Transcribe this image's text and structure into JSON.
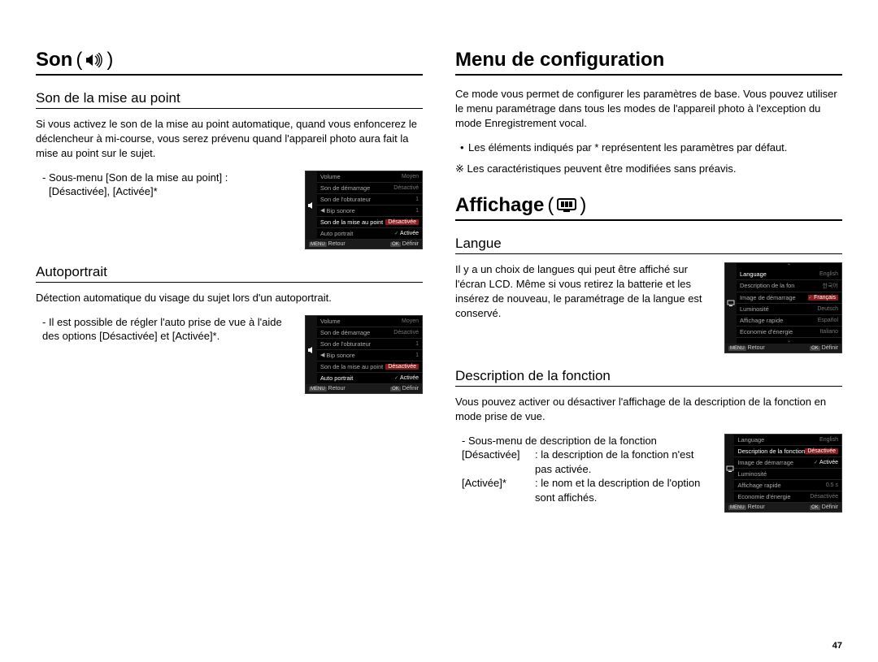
{
  "page_number": "47",
  "left": {
    "h1": "Son",
    "h1_paren_open": "(",
    "h1_paren_close": ")",
    "sec1": {
      "heading": "Son de la mise au point",
      "body": "Si vous activez le son de la mise au point automatique, quand vous enfoncerez le déclencheur à mi-course, vous serez prévenu quand l'appareil photo aura fait la mise au point sur le sujet.",
      "submenu_label": "- Sous-menu [Son de la mise au point] :",
      "submenu_options": "[Désactivée], [Activée]*"
    },
    "sec2": {
      "heading": "Autoportrait",
      "body": "Détection automatique du visage du sujet lors d'un autoportrait.",
      "submenu_label": "- Il est possible de régler l'auto prise de vue à l'aide des options [Désactivée] et [Activée]*."
    },
    "screenshot_sound": {
      "items": [
        {
          "label": "Volume",
          "value": "Moyen"
        },
        {
          "label": "Son de démarrage",
          "value": "Désactivé"
        },
        {
          "label": "Son de l'obturateur",
          "value": "1"
        },
        {
          "label": "Bip sonore",
          "value": "1"
        },
        {
          "label": "Son de la mise au point",
          "value": "Désactivée"
        },
        {
          "label": "Auto portrait",
          "value": "Activée"
        }
      ],
      "footer_left_btn": "MENU",
      "footer_left": "Retour",
      "footer_right_btn": "OK",
      "footer_right": "Définir"
    }
  },
  "right": {
    "h1_config": "Menu de configuration",
    "config_body": "Ce mode vous permet de configurer les paramètres de base. Vous pouvez utiliser le menu paramétrage dans tous les modes de l'appareil photo à l'exception du mode Enregistrement vocal.",
    "bullet": "Les éléments indiqués par * représentent les paramètres par défaut.",
    "asterisk": "※ Les caractéristiques peuvent être modifiées sans préavis.",
    "h1_affichage": "Affichage",
    "h1_paren_open": "(",
    "h1_paren_close": ")",
    "langue": {
      "heading": "Langue",
      "body": "Il y a un choix de langues qui peut être affiché sur l'écran LCD. Même si vous retirez la batterie et les insérez de nouveau, le paramétrage de la langue est conservé."
    },
    "screenshot_lang": {
      "items": [
        {
          "label": "Language",
          "value": "English"
        },
        {
          "label": "Description de la fon",
          "value": "한국어"
        },
        {
          "label": "Image de démarrage",
          "value": "Français"
        },
        {
          "label": "Luminosité",
          "value": "Deutsch"
        },
        {
          "label": "Affichage rapide",
          "value": "Español"
        },
        {
          "label": "Economie d'énergie",
          "value": "Italiano"
        }
      ],
      "footer_left_btn": "MENU",
      "footer_left": "Retour",
      "footer_right_btn": "OK",
      "footer_right": "Définir"
    },
    "desc": {
      "heading": "Description de la fonction",
      "body": "Vous pouvez activer ou désactiver l'affichage de la description de la fonction en mode prise de vue.",
      "submenu_intro": "- Sous-menu de description de la fonction",
      "row1_key": "[Désactivée]",
      "row1_val": ": la description de la fonction n'est pas activée.",
      "row2_key": "[Activée]*",
      "row2_val": ": le nom et la description de l'option sont affichés."
    },
    "screenshot_desc": {
      "items": [
        {
          "label": "Language",
          "value": "English"
        },
        {
          "label": "Description de la fonction",
          "value": "Désactivée"
        },
        {
          "label": "Image de démarrage",
          "value": "Activée"
        },
        {
          "label": "Luminosité",
          "value": ""
        },
        {
          "label": "Affichage rapide",
          "value": "0.5 s"
        },
        {
          "label": "Economie d'énergie",
          "value": "Désactivée"
        }
      ],
      "footer_left_btn": "MENU",
      "footer_left": "Retour",
      "footer_right_btn": "OK",
      "footer_right": "Définir"
    }
  }
}
